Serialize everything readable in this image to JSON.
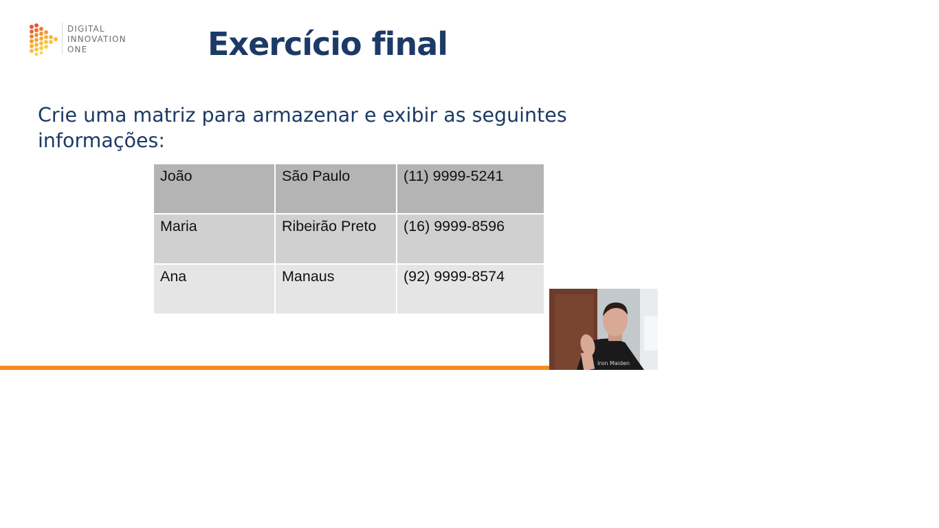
{
  "logo": {
    "line1": "DIGITAL",
    "line2": "INNOVATION",
    "line3": "ONE"
  },
  "slide": {
    "title": "Exercício final",
    "instruction": "Crie uma matriz para armazenar e exibir as seguintes informações:"
  },
  "table": {
    "rows": [
      {
        "name": "João",
        "city": "São Paulo",
        "phone": "(11) 9999-5241"
      },
      {
        "name": "Maria",
        "city": "Ribeirão Preto",
        "phone": "(16) 9999-8596"
      },
      {
        "name": "Ana",
        "city": "Manaus",
        "phone": "(92) 9999-8574"
      }
    ]
  },
  "colors": {
    "title": "#1c3a66",
    "accent_bar": "#f48a20",
    "row_dark": "#b4b4b4",
    "row_mid": "#d0d0d0",
    "row_light": "#e5e5e5"
  },
  "webcam": {
    "shirt_text": "Iron Maiden"
  }
}
